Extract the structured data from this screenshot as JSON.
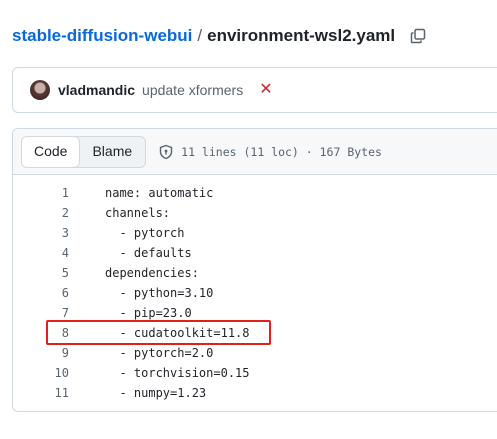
{
  "breadcrumb": {
    "repo": "stable-diffusion-webui",
    "separator": "/",
    "file": "environment-wsl2.yaml"
  },
  "commit": {
    "author": "vladmandic",
    "message": "update xformers",
    "status_icon": "x-icon",
    "status_color": "#d1242f"
  },
  "file_header": {
    "tabs": [
      {
        "label": "Code",
        "active": true
      },
      {
        "label": "Blame",
        "active": false
      }
    ],
    "info": "11 lines (11 loc) · 167 Bytes"
  },
  "code_lines": [
    {
      "num": "1",
      "text": "name: automatic"
    },
    {
      "num": "2",
      "text": "channels:"
    },
    {
      "num": "3",
      "text": "  - pytorch"
    },
    {
      "num": "4",
      "text": "  - defaults"
    },
    {
      "num": "5",
      "text": "dependencies:"
    },
    {
      "num": "6",
      "text": "  - python=3.10"
    },
    {
      "num": "7",
      "text": "  - pip=23.0"
    },
    {
      "num": "8",
      "text": "  - cudatoolkit=11.8"
    },
    {
      "num": "9",
      "text": "  - pytorch=2.0"
    },
    {
      "num": "10",
      "text": "  - torchvision=0.15"
    },
    {
      "num": "11",
      "text": "  - numpy=1.23"
    }
  ],
  "highlight": {
    "line": "8",
    "color": "#e0201b"
  }
}
